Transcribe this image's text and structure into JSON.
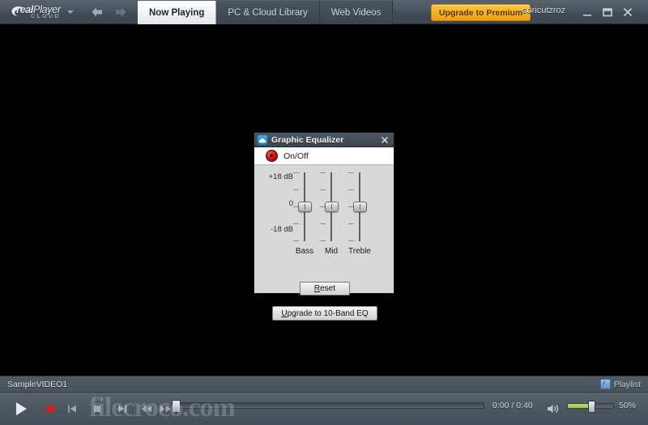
{
  "window": {
    "brand_name": "real",
    "brand_name_2": "Player",
    "brand_sub": "CLOUD",
    "username": "soricutzroz",
    "upgrade_label": "Upgrade to Premium",
    "minimize_label": "Minimize",
    "maximize_label": "Restore",
    "close_label": "Close",
    "back_label": "Back",
    "forward_label": "Forward"
  },
  "tabs": [
    {
      "label": "Now Playing",
      "active": true
    },
    {
      "label": "PC & Cloud Library",
      "active": false
    },
    {
      "label": "Web Videos",
      "active": false
    }
  ],
  "status": {
    "title": "SampleVIDEO1",
    "playlist_label": "Playlist"
  },
  "player": {
    "play_label": "Play",
    "record_label": "Record",
    "previous_label": "Previous",
    "stop_label": "Stop",
    "next_label": "Next",
    "rewind_label": "Rewind",
    "fastforward_label": "Fast Forward",
    "time_display": "0:00 / 0:40",
    "progress_percent": 0,
    "volume_label": "50%",
    "volume_percent": 50
  },
  "equalizer": {
    "title": "Graphic Equalizer",
    "icon": "cloud-icon",
    "close_label": "Close",
    "onoff_label": "On/Off",
    "scale": {
      "top": "+18 dB",
      "middle": "0",
      "bottom": "-18 dB"
    },
    "bands": [
      {
        "label": "Bass",
        "value": 0
      },
      {
        "label": "Mid",
        "value": 0
      },
      {
        "label": "Treble",
        "value": 0
      }
    ],
    "reset_button": {
      "mnemonic": "R",
      "rest": "eset"
    },
    "upgrade_button": {
      "mnemonic": "U",
      "rest": "pgrade to 10-Band EQ"
    }
  },
  "watermark": {
    "text": "filecroco.com"
  },
  "colors": {
    "accent_orange": "#f0a517",
    "chrome_dark": "#454e58",
    "video_black": "#000000",
    "volume_green": "#8cc93c",
    "led_red": "#cc1414"
  }
}
